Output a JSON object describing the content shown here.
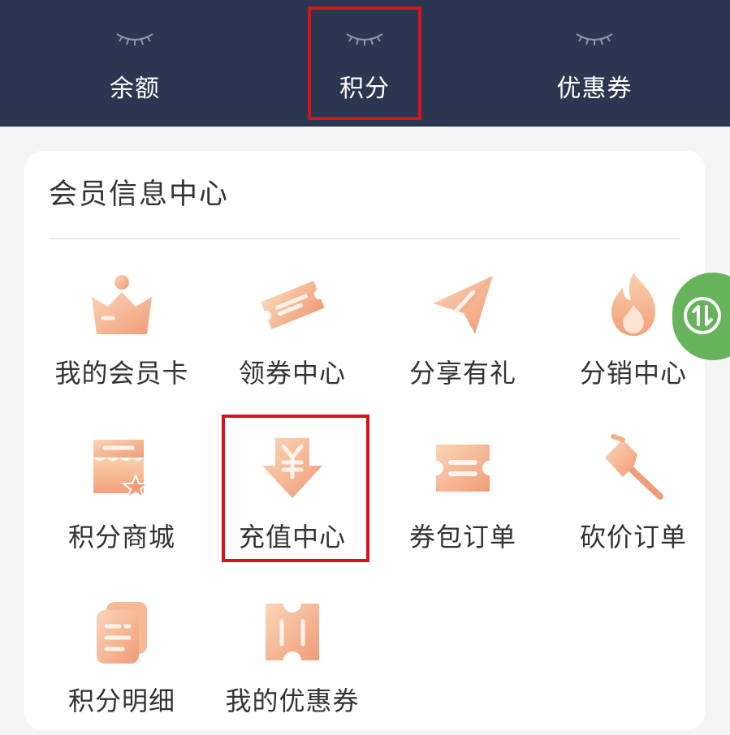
{
  "stats": [
    {
      "label": "余额",
      "icon": "eye-closed-icon"
    },
    {
      "label": "积分",
      "icon": "eye-closed-icon"
    },
    {
      "label": "优惠券",
      "icon": "eye-closed-icon"
    }
  ],
  "card": {
    "title": "会员信息中心",
    "items": [
      {
        "label": "我的会员卡",
        "icon": "crown-icon"
      },
      {
        "label": "领券中心",
        "icon": "ticket-icon"
      },
      {
        "label": "分享有礼",
        "icon": "paper-plane-icon"
      },
      {
        "label": "分销中心",
        "icon": "flame-icon"
      },
      {
        "label": "积分商城",
        "icon": "store-icon"
      },
      {
        "label": "充值中心",
        "icon": "yen-arrow-down-icon"
      },
      {
        "label": "券包订单",
        "icon": "coupon-icon"
      },
      {
        "label": "砍价订单",
        "icon": "hammer-icon"
      },
      {
        "label": "积分明细",
        "icon": "document-icon"
      },
      {
        "label": "我的优惠券",
        "icon": "voucher-icon"
      }
    ]
  },
  "float_button": {
    "icon": "swap-vertical-icon"
  },
  "colors": {
    "header_bg": "#2b3750",
    "highlight": "#d9121d",
    "icon_gradient_start": "#fbd3b3",
    "icon_gradient_end": "#f19e7a",
    "float_button": "#67b35b"
  }
}
